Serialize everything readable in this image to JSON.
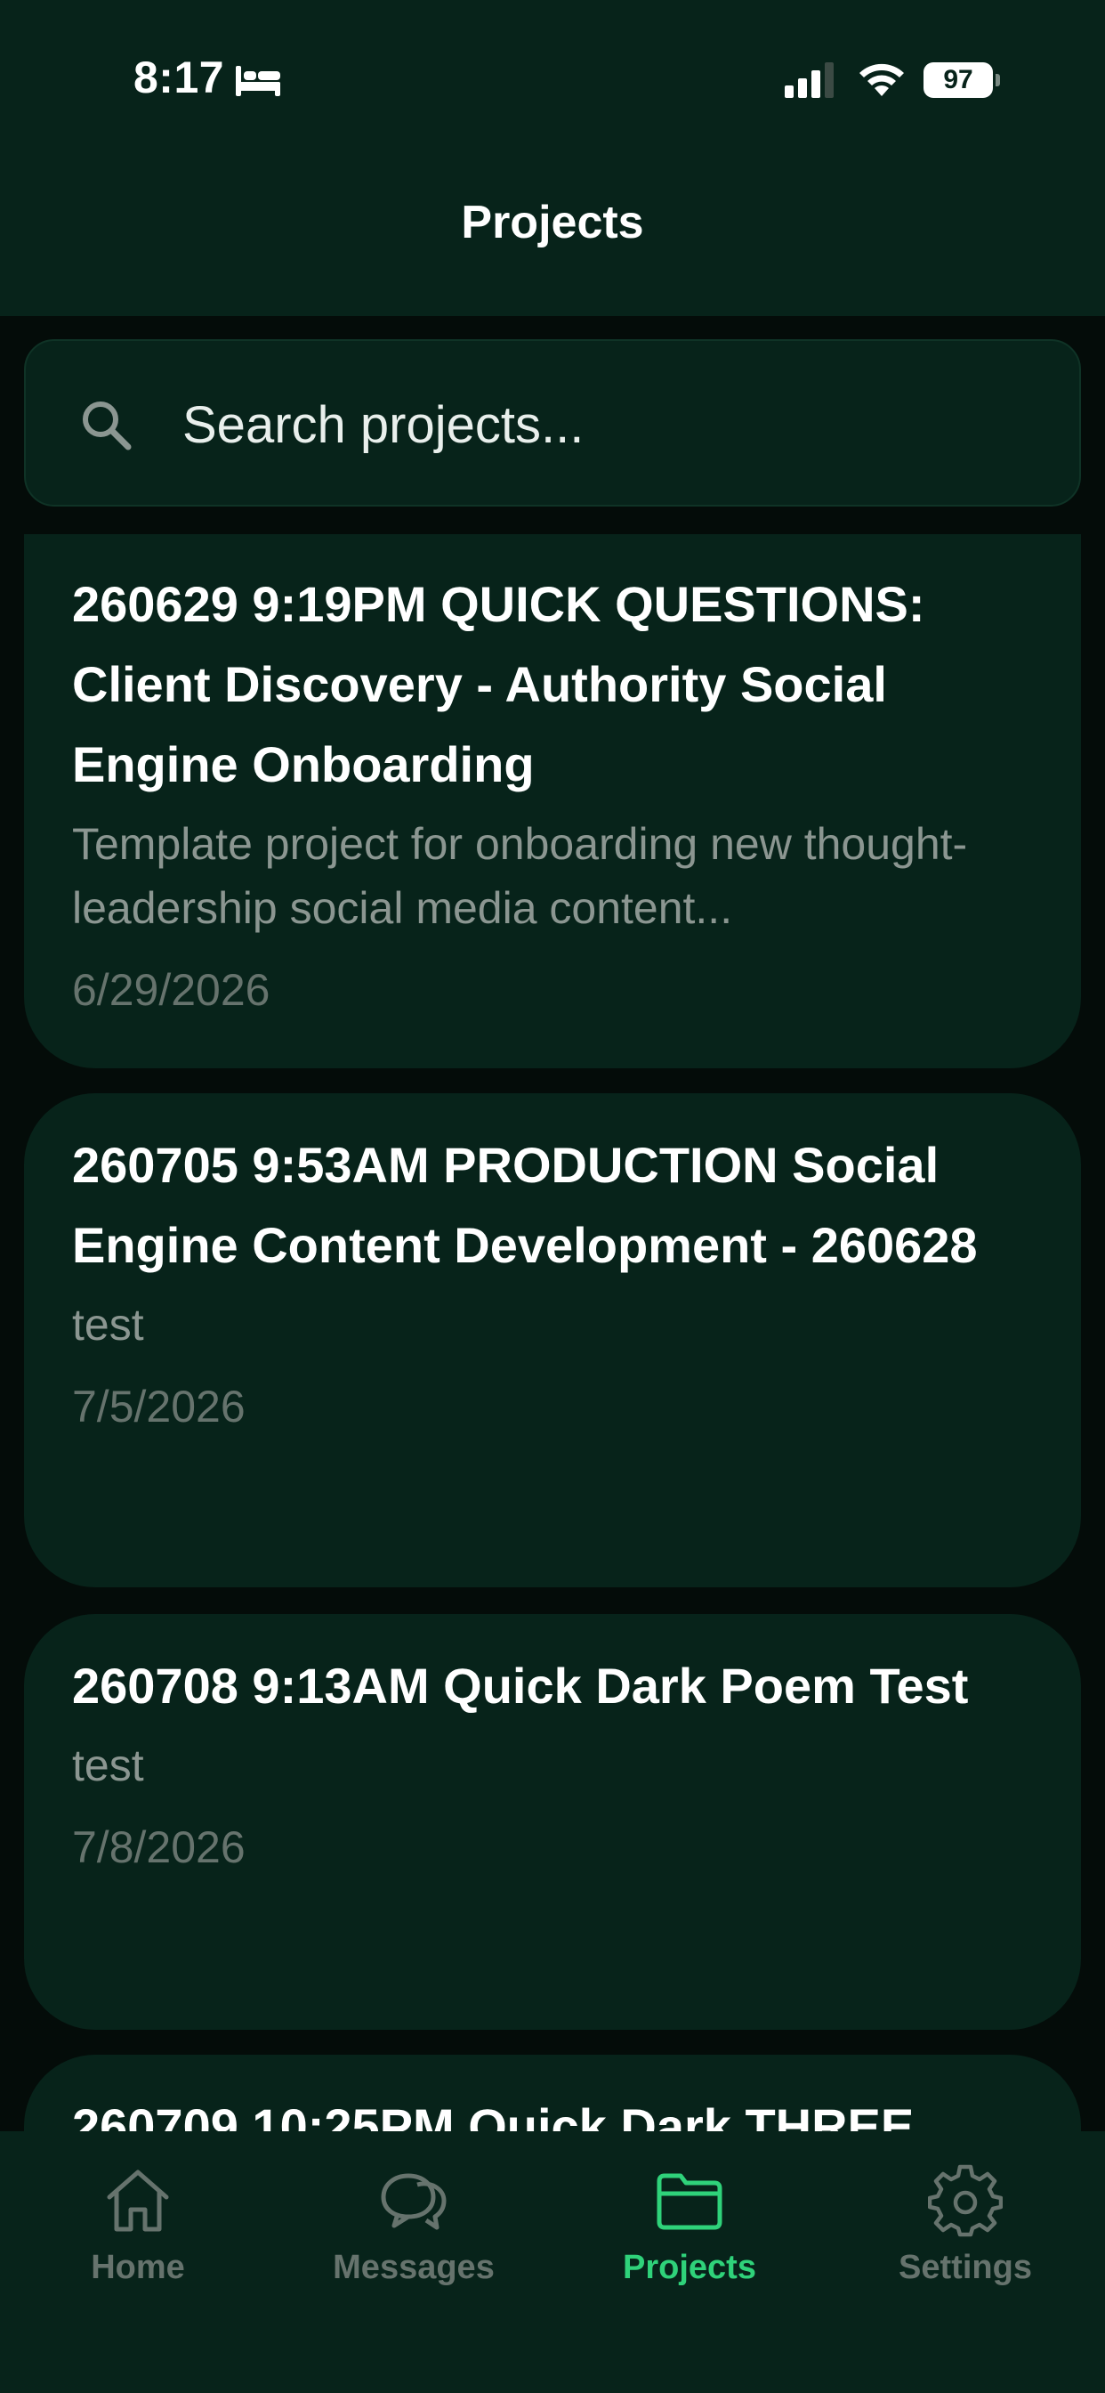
{
  "status_bar": {
    "time": "8:17",
    "battery": "97"
  },
  "header": {
    "title": "Projects"
  },
  "search": {
    "placeholder": "Search projects..."
  },
  "projects": [
    {
      "title": "260629 9:19PM QUICK QUESTIONS: Client Discovery - Authority Social Engine Onboarding",
      "description": "Template project for onboarding new thought-leadership social media content...",
      "date": "6/29/2026"
    },
    {
      "title": "260705 9:53AM PRODUCTION Social Engine Content Development - 260628",
      "description": "test",
      "date": "7/5/2026"
    },
    {
      "title": "260708 9:13AM Quick Dark Poem Test",
      "description": "test",
      "date": "7/8/2026"
    },
    {
      "title": "260709 10:25PM Quick Dark THREE",
      "description": "",
      "date": ""
    }
  ],
  "tabs": [
    {
      "label": "Home",
      "icon": "home-icon"
    },
    {
      "label": "Messages",
      "icon": "messages-icon"
    },
    {
      "label": "Projects",
      "icon": "folder-icon",
      "active": true
    },
    {
      "label": "Settings",
      "icon": "gear-icon"
    }
  ],
  "colors": {
    "background": "#040c09",
    "surface": "#07231a",
    "accent": "#2fd27a",
    "muted": "#66736d"
  }
}
